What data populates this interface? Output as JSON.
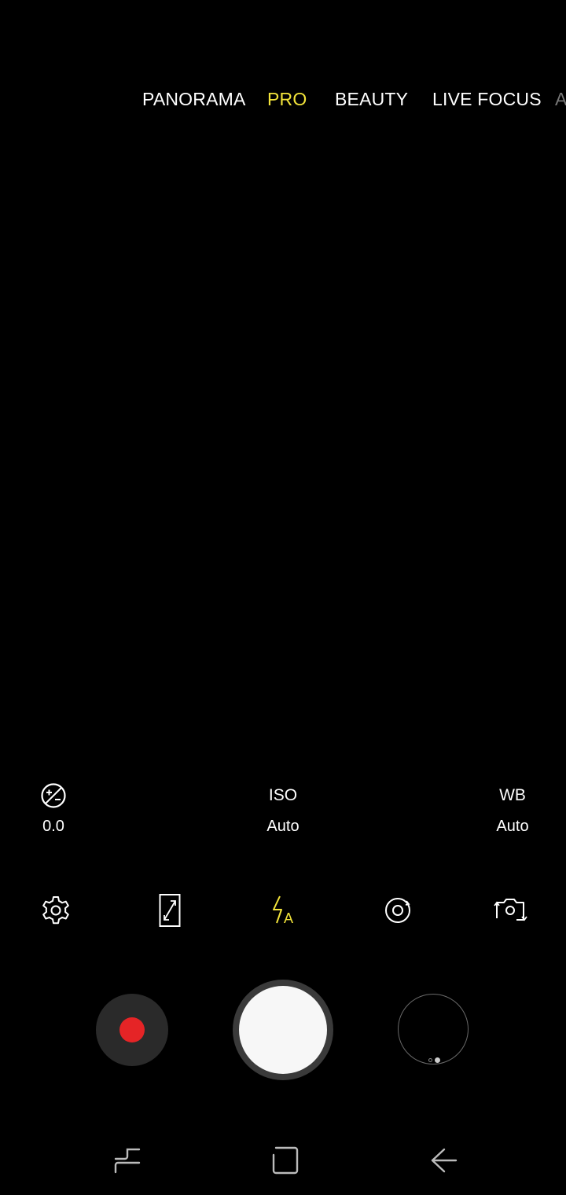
{
  "modes": {
    "items": [
      "PANORAMA",
      "PRO",
      "BEAUTY",
      "LIVE FOCUS",
      "A"
    ],
    "active": "PRO"
  },
  "pro_settings": {
    "exposure": {
      "icon": "exposure-icon",
      "value": "0.0"
    },
    "iso": {
      "label": "ISO",
      "value": "Auto"
    },
    "wb": {
      "label": "WB",
      "value": "Auto"
    }
  },
  "quick_icons": [
    "gear-icon",
    "aspect-ratio-icon",
    "flash-auto-icon",
    "effects-icon",
    "switch-camera-icon"
  ],
  "colors": {
    "accent": "#f2e33a",
    "record": "#e52426",
    "background": "#000000"
  },
  "capture": {
    "record_icon": "record-icon",
    "shutter_icon": "shutter-icon",
    "gallery_icon": "gallery-thumbnail"
  },
  "navbar": [
    "recents-icon",
    "home-icon",
    "back-icon"
  ]
}
